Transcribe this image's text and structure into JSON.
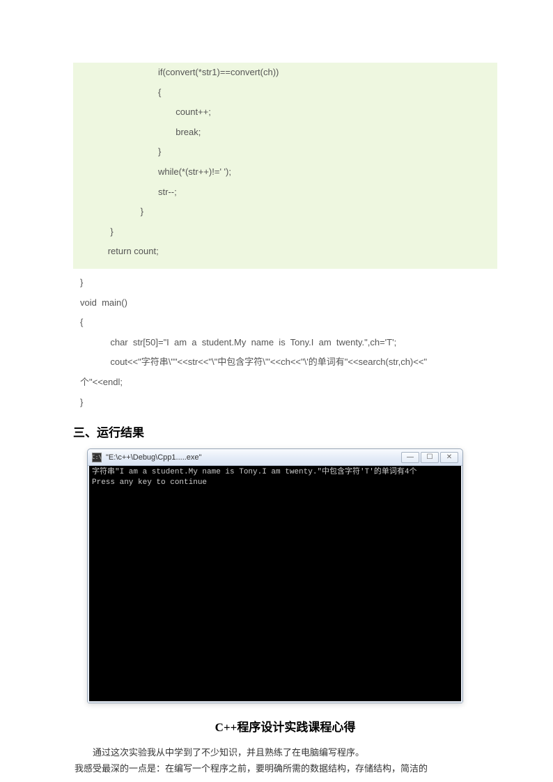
{
  "codeGreen": [
    "                               if(convert(*str1)==convert(ch))",
    "                               {",
    "                                      count++;",
    "                                      break;",
    "                               }",
    "                               while(*(str++)!=' ');",
    "                               str--;",
    "                        }",
    "            }",
    "           return count;"
  ],
  "codePlain": [
    "}",
    "void  main()",
    "{",
    "            char  str[50]=\"I  am  a  student.My  name  is  Tony.I  am  twenty.\",ch='T';",
    "            cout<<\"字符串\\\"\"<<str<<\"\\\"中包含字符\\'\"<<ch<<\"\\'的单词有\"<<search(str,ch)<<\"",
    "个\"<<endl;",
    "}"
  ],
  "heading1": "三、运行结果",
  "window": {
    "title": "\"E:\\c++\\Debug\\Cpp1.....exe\"",
    "line1": "字符串\"I am a student.My name is Tony.I am twenty.\"中包含字符'T'的单词有4个",
    "line2": "Press any key to continue"
  },
  "heading2": "C++程序设计实践课程心得",
  "para1": "通过这次实验我从中学到了不少知识，并且熟练了在电脑编写程序。",
  "para2": "我感受最深的一点是：在编写一个程序之前，要明确所需的数据结构，存储结构，简洁的"
}
